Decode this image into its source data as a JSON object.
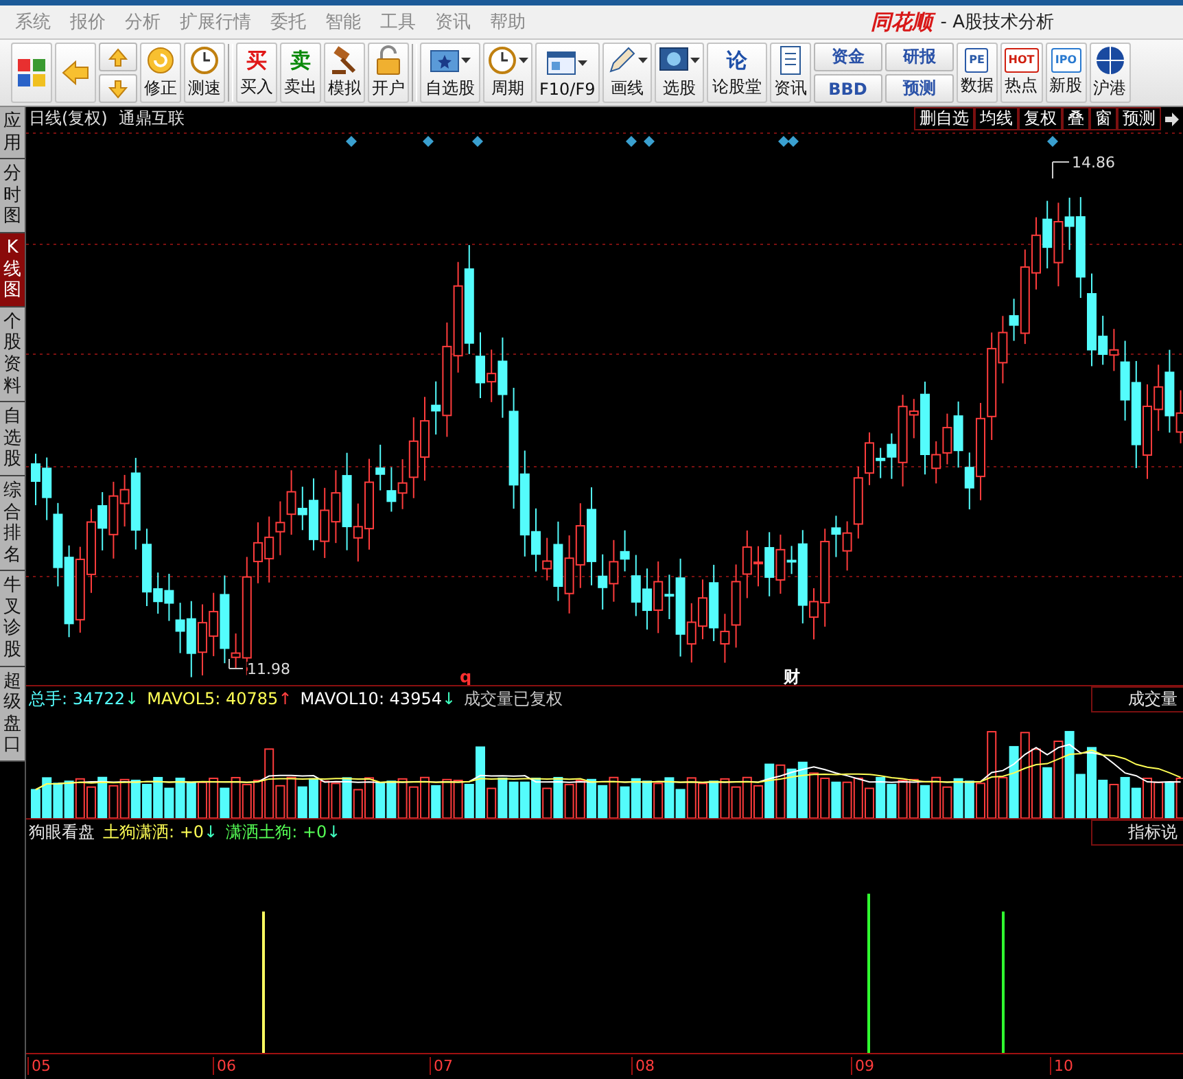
{
  "menu": {
    "items": [
      "系统",
      "报价",
      "分析",
      "扩展行情",
      "委托",
      "智能",
      "工具",
      "资讯",
      "帮助"
    ],
    "logo": "同花顺",
    "subtitle": "- A股技术分析"
  },
  "toolbar": [
    {
      "kind": "tool"
    },
    {
      "kind": "tool"
    },
    {
      "kind": "arrow_pair"
    },
    {
      "kind": "tool",
      "label": "修正"
    },
    {
      "kind": "tool",
      "label": "测速"
    },
    {
      "kind": "separator"
    },
    {
      "kind": "glyph_tool",
      "glyph": "买",
      "color": "#e01818",
      "label": "买入"
    },
    {
      "kind": "glyph_tool",
      "glyph": "卖",
      "color": "#0a8a0a",
      "label": "卖出"
    },
    {
      "kind": "tool",
      "label": "模拟"
    },
    {
      "kind": "tool",
      "label": "开户"
    },
    {
      "kind": "separator"
    },
    {
      "kind": "tool",
      "label": "自选股",
      "dropdown": true
    },
    {
      "kind": "tool",
      "label": "周期",
      "dropdown": true
    },
    {
      "kind": "tool",
      "label": "F10/F9",
      "dropdown": true
    },
    {
      "kind": "tool",
      "label": "画线",
      "dropdown": true
    },
    {
      "kind": "tool",
      "label": "选股",
      "dropdown": true
    },
    {
      "kind": "glyph_tool",
      "glyph": "论",
      "color": "#1e4fa8",
      "label": "论股堂"
    },
    {
      "kind": "tool",
      "label": "资讯"
    },
    {
      "kind": "pair",
      "items": [
        {
          "label": "资金"
        },
        {
          "label": "BBD"
        }
      ]
    },
    {
      "kind": "pair",
      "items": [
        {
          "label": "研报"
        },
        {
          "label": "预测"
        }
      ]
    },
    {
      "kind": "badge_tool",
      "glyph": "PE",
      "color": "#2a5aa8",
      "label": "数据"
    },
    {
      "kind": "badge_tool",
      "glyph": "HOT",
      "color": "#d02010",
      "label": "热点"
    },
    {
      "kind": "badge_tool",
      "glyph": "IPO",
      "color": "#2a7ad0",
      "label": "新股"
    },
    {
      "kind": "tool",
      "label": "沪港"
    }
  ],
  "side_tabs": [
    {
      "label": "应用",
      "selected": false
    },
    {
      "label": "分时图",
      "selected": false
    },
    {
      "label": "K线图",
      "selected": true
    },
    {
      "label": "个股资料",
      "selected": false
    },
    {
      "label": "自选股",
      "selected": false
    },
    {
      "label": "综合排名",
      "selected": false
    },
    {
      "label": "牛叉诊股",
      "selected": false
    },
    {
      "label": "超级盘口",
      "selected": false
    }
  ],
  "chart_header": {
    "period": "日线(复权)",
    "stock": "通鼎互联",
    "buttons": [
      "删自选",
      "均线",
      "复权",
      "叠",
      "窗",
      "预测"
    ]
  },
  "price_panel": {
    "high_label": "14.86",
    "low_label": "11.98",
    "markers": [
      {
        "text": "q",
        "color": "#ff3030"
      },
      {
        "text": "财",
        "color": "#ffffff"
      }
    ]
  },
  "volume_panel": {
    "legend": [
      {
        "kind": "value",
        "text": "总手: 34722",
        "color": "#55ffff"
      },
      {
        "kind": "arrow",
        "text": "↓",
        "color": "#40ffc0"
      },
      {
        "kind": "value",
        "text": "MAVOL5: 40785",
        "color": "#ffff55"
      },
      {
        "kind": "arrow",
        "text": "↑",
        "color": "#ff4040"
      },
      {
        "kind": "value",
        "text": "MAVOL10: 43954",
        "color": "#ffffff"
      },
      {
        "kind": "arrow",
        "text": "↓",
        "color": "#40ffc0"
      },
      {
        "kind": "value",
        "text": "成交量已复权",
        "color": "#c8c8c8"
      }
    ],
    "title": "成交量"
  },
  "indicator_panel": {
    "legend": [
      {
        "kind": "value",
        "text": "狗眼看盘",
        "color": "#e8e8e8"
      },
      {
        "kind": "value",
        "text": "土狗潇洒: +0",
        "color": "#ffff55"
      },
      {
        "kind": "arrow",
        "text": "↓",
        "color": "#40ffc0"
      },
      {
        "kind": "value",
        "text": "潇洒土狗: +0",
        "color": "#55ff55"
      },
      {
        "kind": "arrow",
        "text": "↓",
        "color": "#40ffc0"
      }
    ],
    "title": "指标说"
  },
  "x_axis": [
    "05",
    "06",
    "07",
    "08",
    "09",
    "10"
  ]
}
